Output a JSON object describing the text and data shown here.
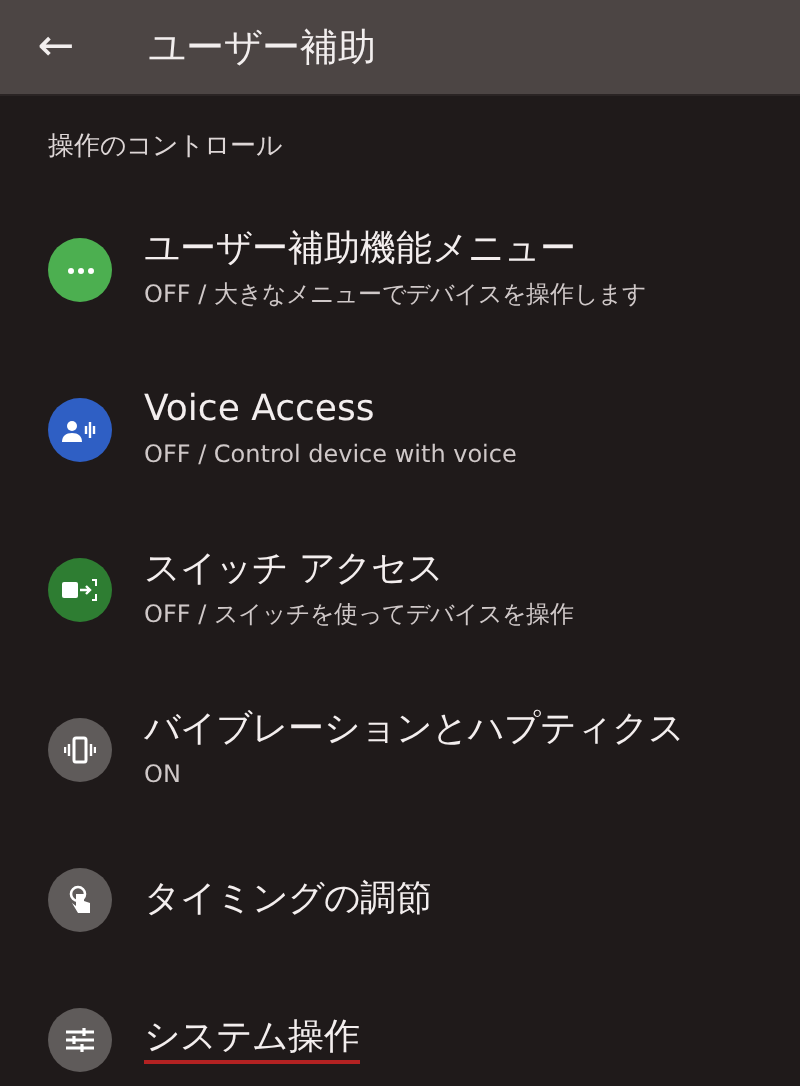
{
  "app_bar": {
    "back": "←",
    "title": "ユーザー補助"
  },
  "section": {
    "title": "操作のコントロール"
  },
  "items": [
    {
      "title": "ユーザー補助機能メニュー",
      "subtitle": "OFF / 大きなメニューでデバイスを操作します",
      "color": "#4caf50",
      "underlined": false
    },
    {
      "title": "Voice Access",
      "subtitle": "OFF / Control device with voice",
      "color": "#2f5fc4",
      "underlined": false
    },
    {
      "title": "スイッチ アクセス",
      "subtitle": "OFF / スイッチを使ってデバイスを操作",
      "color": "#2e7d32",
      "underlined": false
    },
    {
      "title": "バイブレーションとハプティクス",
      "subtitle": "ON",
      "color": "#5f5b5a",
      "underlined": false
    },
    {
      "title": "タイミングの調節",
      "color": "#5f5b5a",
      "underlined": false
    },
    {
      "title": "システム操作",
      "color": "#5f5b5a",
      "underlined": true
    }
  ]
}
